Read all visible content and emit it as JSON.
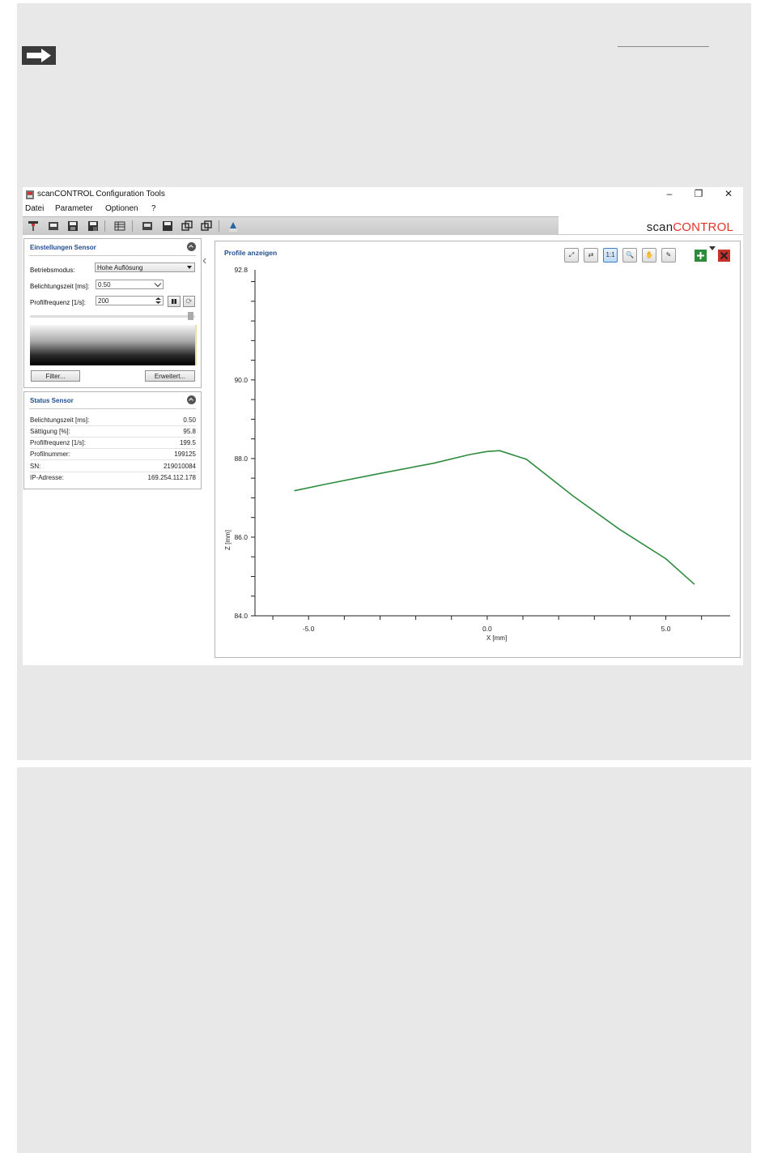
{
  "window": {
    "title": "scanCONTROL Configuration Tools",
    "controls": [
      "–",
      "❐",
      "✕"
    ]
  },
  "menu": [
    "Datei",
    "Parameter",
    "Optionen",
    "?"
  ],
  "brand": {
    "part1": "scan",
    "part2": "CONTROL",
    "accent_color": "#e4322b"
  },
  "settings_panel": {
    "title": "Einstellungen Sensor",
    "mode_label": "Betriebsmodus:",
    "mode_value": "Hohe Auflösung",
    "exposure_label": "Belichtungszeit [ms]:",
    "exposure_value": "0.50",
    "freq_label": "Profilfrequenz [1/s]:",
    "freq_value": "200",
    "filter_button": "Filter...",
    "advanced_button": "Erweitert..."
  },
  "status_panel": {
    "title": "Status Sensor",
    "rows": [
      {
        "k": "Belichtungszeit [ms]:",
        "v": "0.50"
      },
      {
        "k": "Sättigung [%]:",
        "v": "95.8"
      },
      {
        "k": "Profilfrequenz [1/s]:",
        "v": "199.5"
      },
      {
        "k": "Profilnummer:",
        "v": "199125"
      },
      {
        "k": "SN:",
        "v": "219010084"
      },
      {
        "k": "IP-Adresse:",
        "v": "169.254.112.178"
      }
    ]
  },
  "chart_panel": {
    "title": "Profile anzeigen",
    "buttons": [
      {
        "name": "zoom-fit-icon",
        "glyph": "⤢"
      },
      {
        "name": "autoscale-icon",
        "glyph": "⇄"
      },
      {
        "name": "one-to-one-icon",
        "glyph": "1:1",
        "active": true
      },
      {
        "name": "zoom-icon",
        "glyph": "🔍"
      },
      {
        "name": "pan-hand-icon",
        "glyph": "✋"
      },
      {
        "name": "eyedropper-icon",
        "glyph": "✎"
      }
    ]
  },
  "chart_data": {
    "type": "line",
    "xlabel": "X [mm]",
    "ylabel": "Z [mm]",
    "x_tick_labels": [
      "-5.0",
      "0.0",
      "5.0"
    ],
    "y_tick_labels": [
      "92.8",
      "90.0",
      "88.0",
      "86.0",
      "84.0"
    ],
    "xlim": [
      -6.5,
      6.8
    ],
    "ylim": [
      84.0,
      92.8
    ],
    "grid": false,
    "line_color": "#2e8b3e",
    "series": [
      {
        "x": [
          -5.4,
          -4.5,
          -3.0,
          -1.5,
          -0.5,
          0.0,
          0.35,
          1.1,
          2.4,
          3.7,
          5.0,
          5.8
        ],
        "values": [
          87.18,
          87.35,
          87.62,
          87.88,
          88.1,
          88.18,
          88.2,
          87.98,
          87.05,
          86.2,
          85.45,
          84.8
        ]
      }
    ]
  }
}
